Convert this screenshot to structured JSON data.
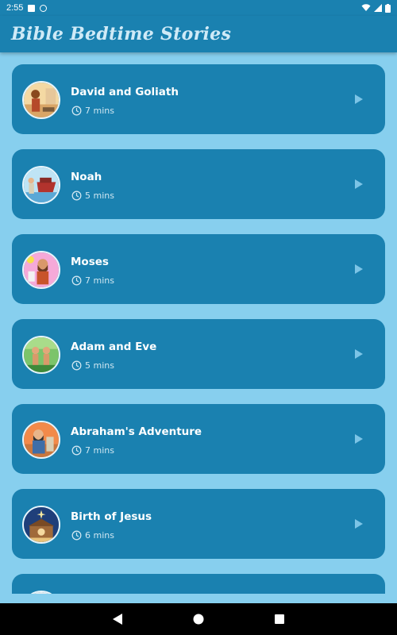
{
  "status_bar": {
    "time": "2:55"
  },
  "app": {
    "title": "Bible Bedtime Stories"
  },
  "stories": [
    {
      "title": "David and Goliath",
      "duration": "7 mins"
    },
    {
      "title": "Noah",
      "duration": "5 mins"
    },
    {
      "title": "Moses",
      "duration": "7 mins"
    },
    {
      "title": "Adam and Eve",
      "duration": "5 mins"
    },
    {
      "title": "Abraham's Adventure",
      "duration": "7 mins"
    },
    {
      "title": "Birth of Jesus",
      "duration": "6 mins"
    },
    {
      "title": "",
      "duration": ""
    }
  ],
  "icons": {
    "duration": "clock-icon",
    "play": "play-icon",
    "nav": [
      "back-icon",
      "home-icon",
      "recents-icon"
    ]
  },
  "colors": {
    "background": "#87cfee",
    "card": "#1a81b0",
    "app_bar": "#1a81b0",
    "title_text": "#ffffff",
    "subtitle_text": "#cfe6f1"
  }
}
